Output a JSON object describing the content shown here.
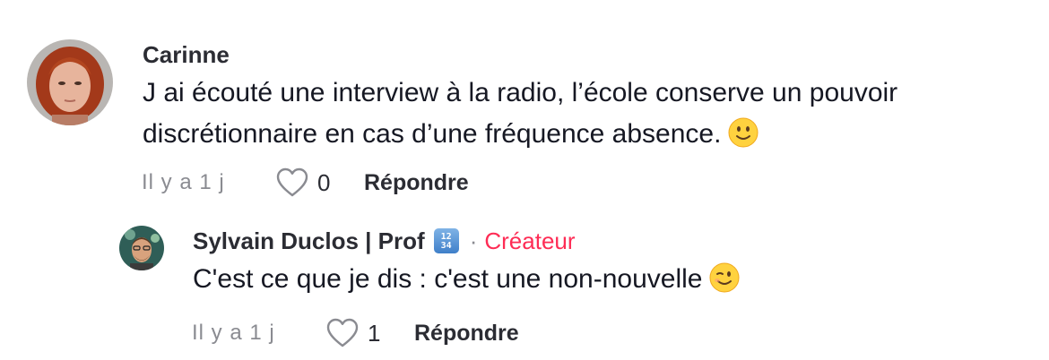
{
  "comments": [
    {
      "author": "Carinne",
      "text_lines": [
        "J ai écouté une interview à la radio, l’école conserve un pouvoir",
        "discrétionnaire en cas d’une fréquence absence."
      ],
      "emoji": "slightly-smiling-face",
      "timestamp": "Il y a 1 j",
      "likes": "0",
      "reply_label": "Répondre",
      "is_creator": false
    },
    {
      "author": "Sylvain Duclos | Prof",
      "badge": "1234",
      "separator": "·",
      "creator_label": "Créateur",
      "text_lines": [
        "C'est ce que je dis : c'est une non-nouvelle"
      ],
      "emoji": "winking-face",
      "timestamp": "Il y a 1 j",
      "likes": "1",
      "reply_label": "Répondre",
      "is_creator": true
    }
  ],
  "colors": {
    "creator": "#fe2c55",
    "secondary_text": "#8a8b91",
    "primary_text": "#161823"
  }
}
